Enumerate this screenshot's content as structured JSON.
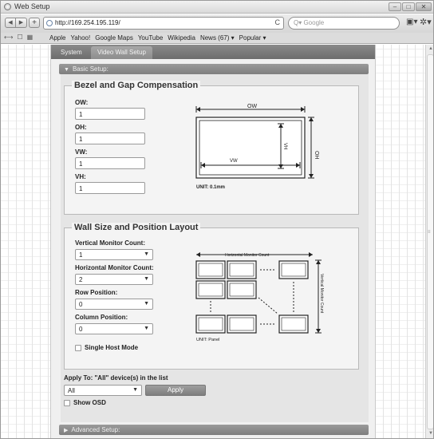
{
  "window": {
    "title": "Web Setup",
    "minimize": "–",
    "maximize": "□",
    "close": "✕"
  },
  "toolbar": {
    "back": "◀",
    "forward": "▶",
    "add": "+",
    "url": "http://169.254.195.119/",
    "reload": "C",
    "search_placeholder": "Q▾ Google"
  },
  "bookmarks": {
    "icons": [
      "⟷",
      "☐",
      "▦"
    ],
    "items": [
      "Apple",
      "Yahoo!",
      "Google Maps",
      "YouTube",
      "Wikipedia",
      "News (67) ▾",
      "Popular ▾"
    ]
  },
  "tabs": {
    "system": "System",
    "video_wall": "Video Wall Setup"
  },
  "basic_setup": {
    "label": "Basic Setup:",
    "arrow": "▼"
  },
  "bezel": {
    "title": "Bezel and Gap Compensation",
    "fields": [
      {
        "label": "OW:",
        "value": "1"
      },
      {
        "label": "OH:",
        "value": "1"
      },
      {
        "label": "VW:",
        "value": "1"
      },
      {
        "label": "VH:",
        "value": "1"
      }
    ],
    "diagram": {
      "ow": "OW",
      "oh": "OH",
      "vw": "VW",
      "vh": "VH",
      "unit": "UNIT: 0.1mm"
    }
  },
  "wall": {
    "title": "Wall Size and Position Layout",
    "fields": [
      {
        "label": "Vertical Monitor Count:",
        "value": "1"
      },
      {
        "label": "Horizontal Monitor Count:",
        "value": "2"
      },
      {
        "label": "Row Position:",
        "value": "0"
      },
      {
        "label": "Column Position:",
        "value": "0"
      }
    ],
    "diagram": {
      "horizontal": "Horizontal Monitor Count",
      "vertical": "Vertical Monitor Count",
      "unit": "UNIT: Panel"
    },
    "single_host": "Single Host Mode"
  },
  "apply": {
    "label": "Apply To: \"All\" device(s) in the list",
    "select_value": "All",
    "button": "Apply",
    "show_osd": "Show OSD"
  },
  "advanced_setup": {
    "label": "Advanced Setup:",
    "arrow": "▶"
  }
}
